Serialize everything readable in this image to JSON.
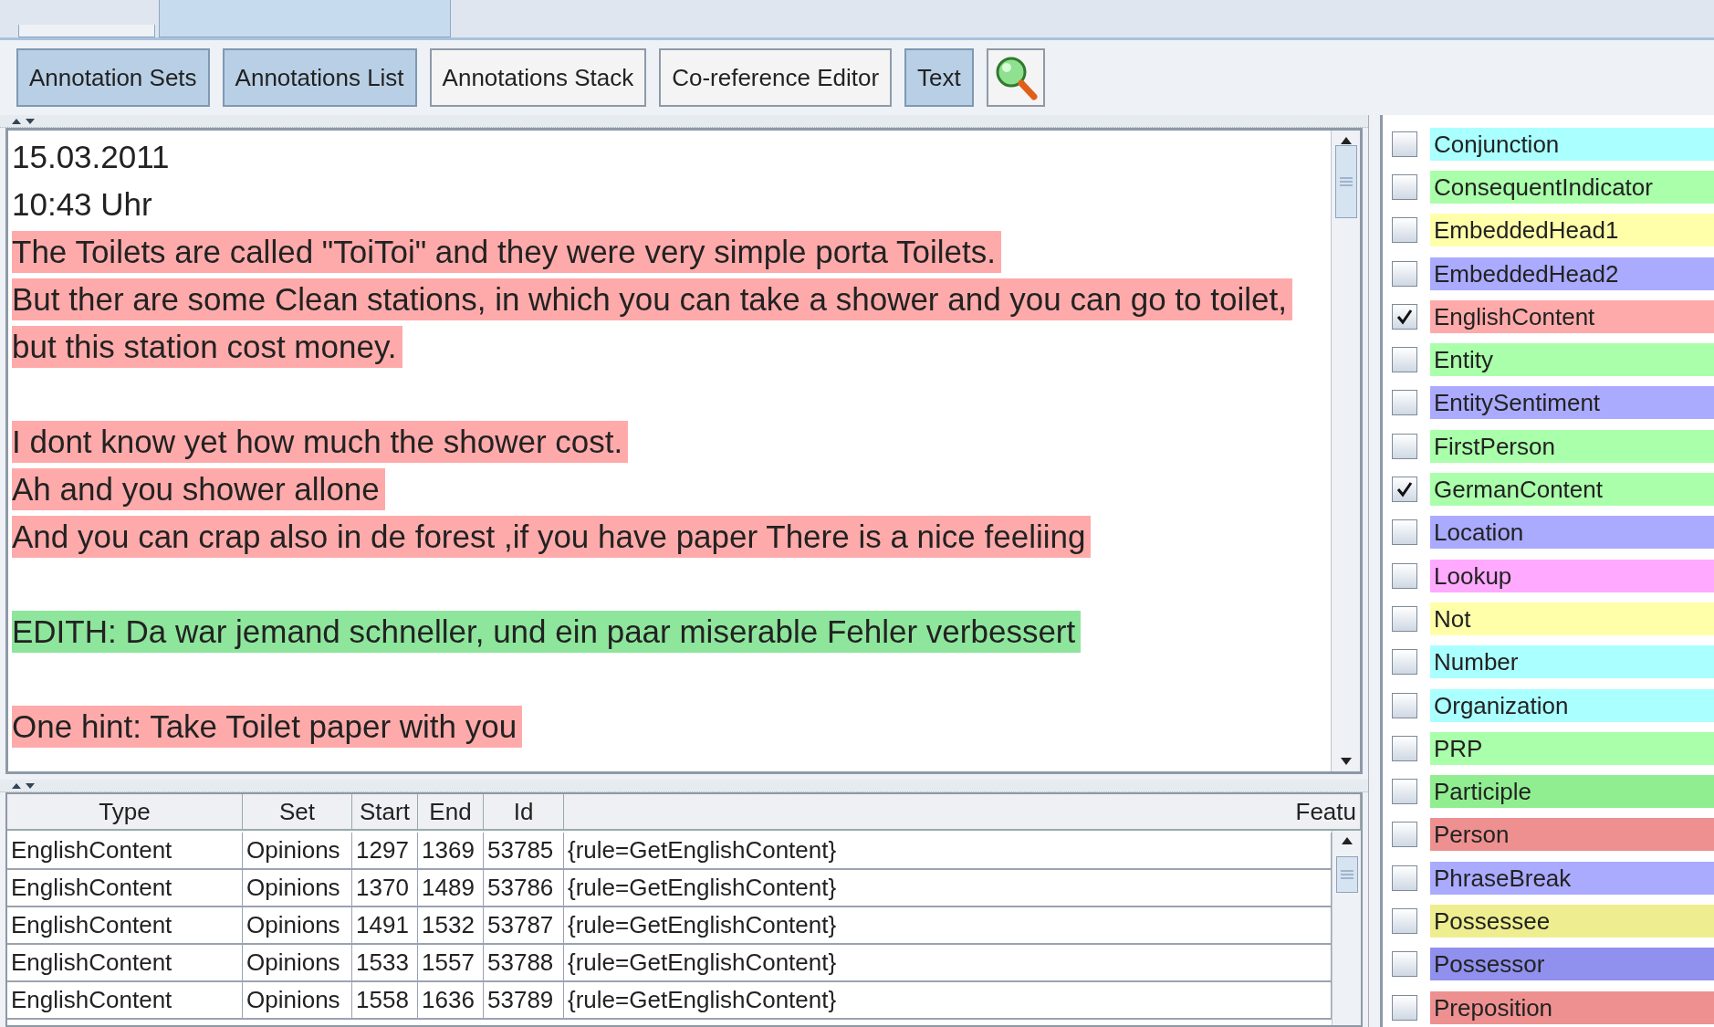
{
  "top_tabs": [
    {
      "selected": false
    },
    {
      "selected": true
    }
  ],
  "toolbar": [
    {
      "label": "Annotation Sets",
      "selected": true
    },
    {
      "label": "Annotations List",
      "selected": true
    },
    {
      "label": "Annotations Stack",
      "selected": false
    },
    {
      "label": "Co-reference Editor",
      "selected": false
    },
    {
      "label": "Text",
      "selected": true
    }
  ],
  "document": {
    "lines": [
      {
        "kind": "plain",
        "text": "15.03.2011"
      },
      {
        "kind": "plain",
        "text": "10:43 Uhr"
      },
      {
        "kind": "annotated",
        "text": "The Toilets are called \"ToiToi\" and they were very simple porta Toilets.",
        "color": "#ffaaaa"
      },
      {
        "kind": "annotated",
        "text": "But ther are some Clean stations, in which you can take a shower and you can go to toilet,",
        "color": "#ffaaaa"
      },
      {
        "kind": "annotated",
        "text": "but this station cost money.",
        "color": "#ffaaaa"
      },
      {
        "kind": "blank"
      },
      {
        "kind": "annotated",
        "text": "I dont know yet how much the shower cost.",
        "color": "#ffaaaa"
      },
      {
        "kind": "annotated",
        "text": "Ah and you shower allone",
        "color": "#ffaaaa"
      },
      {
        "kind": "annotated",
        "text": "And you can crap also in de forest ,if you have paper There is a nice feeliing",
        "color": "#ffaaaa"
      },
      {
        "kind": "blank"
      },
      {
        "kind": "annotated",
        "text": "EDITH: Da war jemand schneller, und ein paar miserable Fehler verbessert",
        "color": "#8ee59c"
      },
      {
        "kind": "blank"
      },
      {
        "kind": "annotated",
        "text": "One hint: Take Toilet paper with you",
        "color": "#ffaaaa"
      }
    ]
  },
  "table": {
    "columns": [
      "Type",
      "Set",
      "Start",
      "End",
      "Id",
      "Featu"
    ],
    "rows": [
      [
        "EnglishContent",
        "Opinions",
        "1297",
        "1369",
        "53785",
        "{rule=GetEnglishContent}"
      ],
      [
        "EnglishContent",
        "Opinions",
        "1370",
        "1489",
        "53786",
        "{rule=GetEnglishContent}"
      ],
      [
        "EnglishContent",
        "Opinions",
        "1491",
        "1532",
        "53787",
        "{rule=GetEnglishContent}"
      ],
      [
        "EnglishContent",
        "Opinions",
        "1533",
        "1557",
        "53788",
        "{rule=GetEnglishContent}"
      ],
      [
        "EnglishContent",
        "Opinions",
        "1558",
        "1636",
        "53789",
        "{rule=GetEnglishContent}"
      ]
    ]
  },
  "annotation_types": [
    {
      "label": "Conjunction",
      "checked": false,
      "color": "#aaffff"
    },
    {
      "label": "ConsequentIndicator",
      "checked": false,
      "color": "#aaffaa"
    },
    {
      "label": "EmbeddedHead1",
      "checked": false,
      "color": "#ffffaa"
    },
    {
      "label": "EmbeddedHead2",
      "checked": false,
      "color": "#aaaaff"
    },
    {
      "label": "EnglishContent",
      "checked": true,
      "color": "#ffaaaa"
    },
    {
      "label": "Entity",
      "checked": false,
      "color": "#aaffaa"
    },
    {
      "label": "EntitySentiment",
      "checked": false,
      "color": "#aaaaff"
    },
    {
      "label": "FirstPerson",
      "checked": false,
      "color": "#aaffaa"
    },
    {
      "label": "GermanContent",
      "checked": true,
      "color": "#aaffaa"
    },
    {
      "label": "Location",
      "checked": false,
      "color": "#aaaaff"
    },
    {
      "label": "Lookup",
      "checked": false,
      "color": "#ffaaff"
    },
    {
      "label": "Not",
      "checked": false,
      "color": "#ffffaa"
    },
    {
      "label": "Number",
      "checked": false,
      "color": "#aaffff"
    },
    {
      "label": "Organization",
      "checked": false,
      "color": "#aaffff"
    },
    {
      "label": "PRP",
      "checked": false,
      "color": "#aaffaa"
    },
    {
      "label": "Participle",
      "checked": false,
      "color": "#90ee90"
    },
    {
      "label": "Person",
      "checked": false,
      "color": "#ee9090"
    },
    {
      "label": "PhraseBreak",
      "checked": false,
      "color": "#aaaaff"
    },
    {
      "label": "Possessee",
      "checked": false,
      "color": "#eeee90"
    },
    {
      "label": "Possessor",
      "checked": false,
      "color": "#9090ee"
    },
    {
      "label": "Preposition",
      "checked": false,
      "color": "#ee9090"
    }
  ]
}
